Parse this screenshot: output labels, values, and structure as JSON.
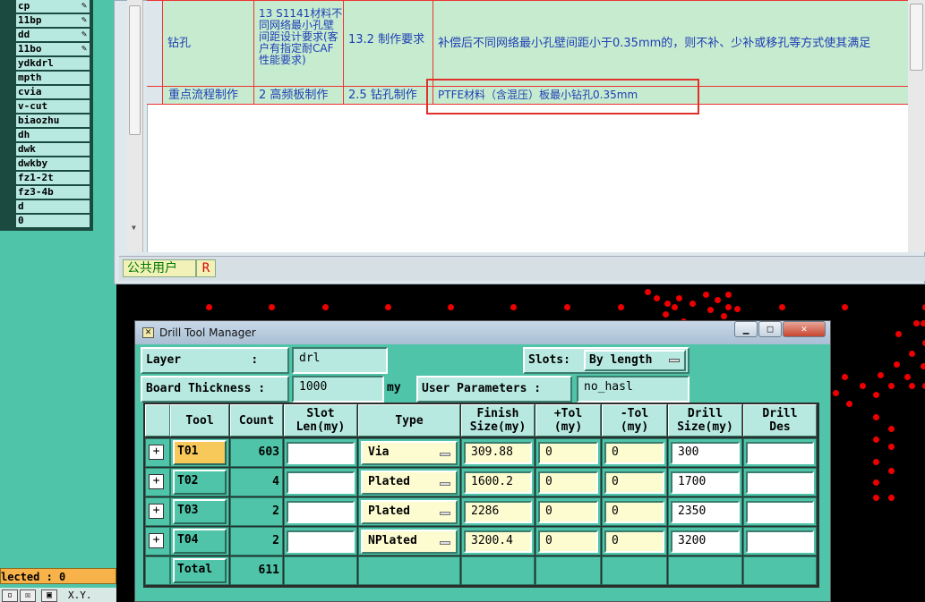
{
  "layers": [
    {
      "name": "cp",
      "pen": true
    },
    {
      "name": "11bp",
      "pen": true
    },
    {
      "name": "dd",
      "pen": true
    },
    {
      "name": "11bo",
      "pen": true
    },
    {
      "name": "ydkdrl"
    },
    {
      "name": "mpth"
    },
    {
      "name": "cvia"
    },
    {
      "name": "v-cut"
    },
    {
      "name": "biaozhu"
    },
    {
      "name": "dh"
    },
    {
      "name": "dwk"
    },
    {
      "name": "dwkby"
    },
    {
      "name": "fz1-2t"
    },
    {
      "name": "fz3-4b"
    },
    {
      "name": "d"
    },
    {
      "name": "0"
    }
  ],
  "selected_text": "lected : 0",
  "bottom_text": "X.Y.",
  "spec_grid": {
    "row1": {
      "c1": "钻孔",
      "c2": "13 S1141材料不同网络最小孔壁间距设计要求(客户有指定耐CAF性能要求)",
      "c3": "13.2 制作要求",
      "c4": "补偿后不同网络最小孔壁间距小于0.35mm的，则不补、少补或移孔等方式使其满足"
    },
    "row2": {
      "c1": "重点流程制作",
      "c2": "2 高频板制作",
      "c3": "2.5 钻孔制作",
      "c4": "PTFE材料（含混压）板最小钻孔0.35mm"
    }
  },
  "tabs": {
    "user": "公共用户",
    "r": "R"
  },
  "dtm": {
    "title": "Drill Tool Manager",
    "layer_label": "Layer          :",
    "layer_value": "drl",
    "slots_label": "Slots:",
    "slots_value": "By length",
    "thickness_label": "Board Thickness :",
    "thickness_value": "1000",
    "thickness_unit": "my",
    "params_label": "User Parameters :",
    "params_value": "no_hasl",
    "headers": {
      "tool": "Tool",
      "count": "Count",
      "slot_len": "Slot\nLen(my)",
      "type": "Type",
      "finish": "Finish\nSize(my)",
      "ptol": "+Tol\n(my)",
      "ntol": "-Tol\n(my)",
      "drill_size": "Drill\nSize(my)",
      "drill_des": "Drill\nDes"
    },
    "rows": [
      {
        "tool": "T01",
        "count": "603",
        "slot": "",
        "type": "Via",
        "finish": "309.88",
        "ptol": "0",
        "ntol": "0",
        "drill": "300",
        "des": ""
      },
      {
        "tool": "T02",
        "count": "4",
        "slot": "",
        "type": "Plated",
        "finish": "1600.2",
        "ptol": "0",
        "ntol": "0",
        "drill": "1700",
        "des": ""
      },
      {
        "tool": "T03",
        "count": "2",
        "slot": "",
        "type": "Plated",
        "finish": "2286",
        "ptol": "0",
        "ntol": "0",
        "drill": "2350",
        "des": ""
      },
      {
        "tool": "T04",
        "count": "2",
        "slot": "",
        "type": "NPlated",
        "finish": "3200.4",
        "ptol": "0",
        "ntol": "0",
        "drill": "3200",
        "des": ""
      }
    ],
    "total_label": "Total",
    "total_count": "611"
  },
  "colors": {
    "accent": "#4fc4a8",
    "highlight": "#e0302a",
    "selected_tool": "#f7c85a"
  }
}
